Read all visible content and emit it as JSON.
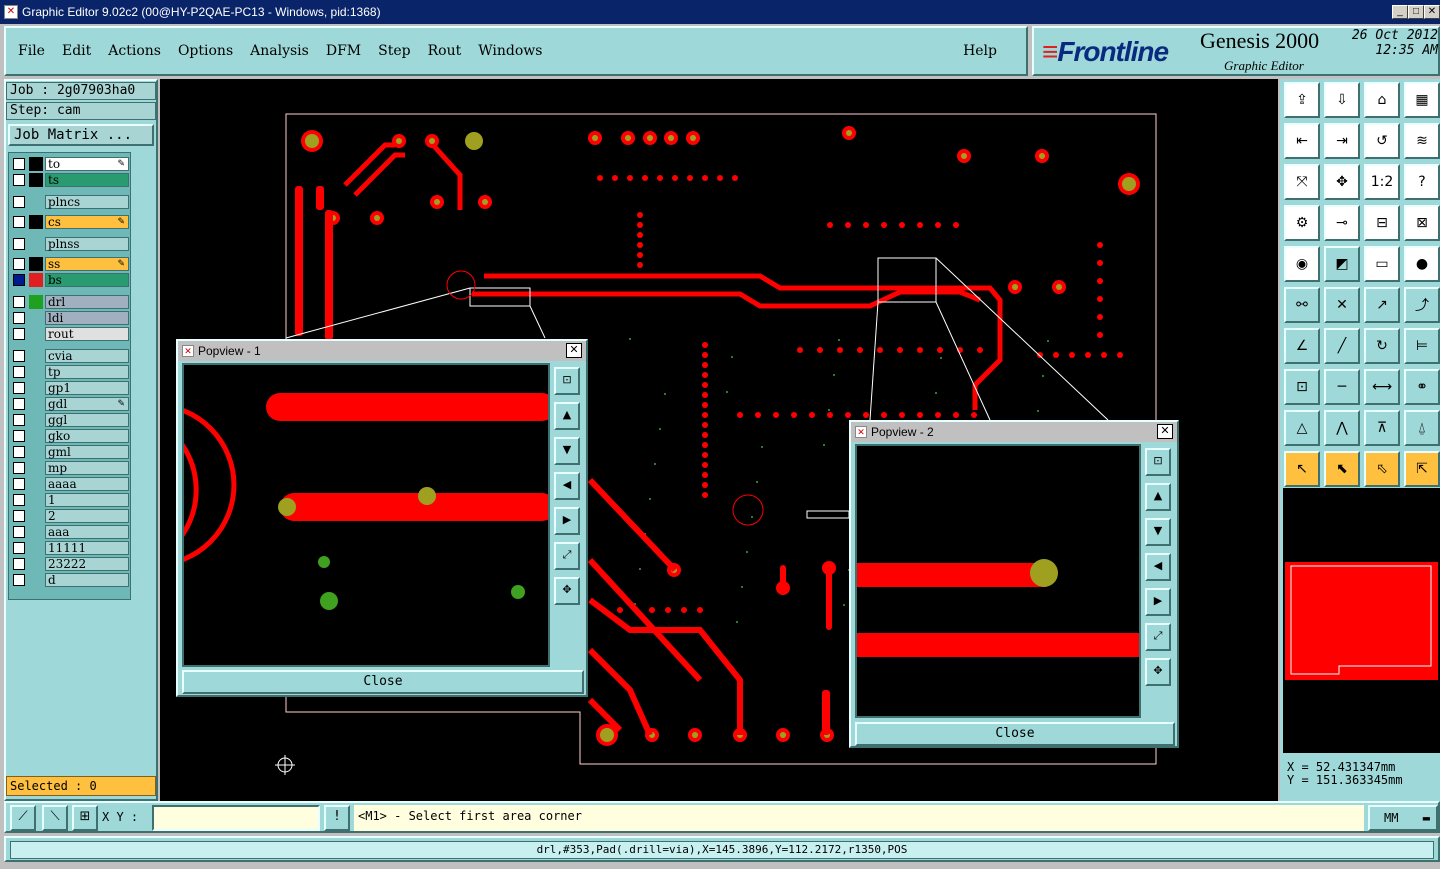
{
  "window": {
    "title": "Graphic Editor 9.02c2 (00@HY-P2QAE-PC13 - Windows, pid:1368)"
  },
  "menu": {
    "items": [
      "File",
      "Edit",
      "Actions",
      "Options",
      "Analysis",
      "DFM",
      "Step",
      "Rout",
      "Windows"
    ],
    "help": "Help"
  },
  "brand": {
    "logo": "Frontline",
    "product": "Genesis 2000",
    "subtitle": "Graphic Editor",
    "date": "26 Oct 2012",
    "time": "12:35 AM"
  },
  "job": {
    "job_label": "Job : 2g07903ha0",
    "step_label": "Step: cam",
    "matrix_button": "Job Matrix ..."
  },
  "layers": [
    {
      "name": "to",
      "color": "#ffffff",
      "swatch": "#000000",
      "checked": false,
      "edit": true
    },
    {
      "name": "ts",
      "color": "#2a9a70",
      "swatch": "#000000",
      "checked": false,
      "edit": false
    },
    {
      "name": "plncs",
      "color": "#a8d4d4",
      "swatch": "",
      "checked": false,
      "edit": false
    },
    {
      "name": "cs",
      "color": "#ffc040",
      "swatch": "#000000",
      "checked": false,
      "edit": true
    },
    {
      "name": "plnss",
      "color": "#a8d4d4",
      "swatch": "",
      "checked": false,
      "edit": false
    },
    {
      "name": "ss",
      "color": "#ffc040",
      "swatch": "#000000",
      "checked": false,
      "edit": true
    },
    {
      "name": "bs",
      "color": "#2a9a70",
      "swatch": "#e02020",
      "checked": true,
      "edit": false
    },
    {
      "name": "drl",
      "color": "#a0b0c0",
      "swatch": "#20a020",
      "checked": false,
      "edit": false
    },
    {
      "name": "ldi",
      "color": "#a0b0c0",
      "swatch": "",
      "checked": false,
      "edit": false
    },
    {
      "name": "rout",
      "color": "#e0e0e0",
      "swatch": "",
      "checked": false,
      "edit": false
    },
    {
      "name": "cvia",
      "color": "#a8d4d4",
      "swatch": "",
      "checked": false,
      "edit": false
    },
    {
      "name": "tp",
      "color": "#a8d4d4",
      "swatch": "",
      "checked": false,
      "edit": false
    },
    {
      "name": "gp1",
      "color": "#a8d4d4",
      "swatch": "",
      "checked": false,
      "edit": false
    },
    {
      "name": "gdl",
      "color": "#a8d4d4",
      "swatch": "",
      "checked": false,
      "edit": true
    },
    {
      "name": "ggl",
      "color": "#a8d4d4",
      "swatch": "",
      "checked": false,
      "edit": false
    },
    {
      "name": "gko",
      "color": "#a8d4d4",
      "swatch": "",
      "checked": false,
      "edit": false
    },
    {
      "name": "gml",
      "color": "#a8d4d4",
      "swatch": "",
      "checked": false,
      "edit": false
    },
    {
      "name": "mp",
      "color": "#a8d4d4",
      "swatch": "",
      "checked": false,
      "edit": false
    },
    {
      "name": "aaaa",
      "color": "#a8d4d4",
      "swatch": "",
      "checked": false,
      "edit": false
    },
    {
      "name": "1",
      "color": "#a8d4d4",
      "swatch": "",
      "checked": false,
      "edit": false
    },
    {
      "name": "2",
      "color": "#a8d4d4",
      "swatch": "",
      "checked": false,
      "edit": false
    },
    {
      "name": "aaa",
      "color": "#a8d4d4",
      "swatch": "",
      "checked": false,
      "edit": false
    },
    {
      "name": "11111",
      "color": "#a8d4d4",
      "swatch": "",
      "checked": false,
      "edit": false
    },
    {
      "name": "23222",
      "color": "#a8d4d4",
      "swatch": "",
      "checked": false,
      "edit": false
    },
    {
      "name": "d",
      "color": "#a8d4d4",
      "swatch": "",
      "checked": false,
      "edit": false
    }
  ],
  "selected": "Selected : 0",
  "popview1": {
    "title": "Popview - 1",
    "close": "Close"
  },
  "popview2": {
    "title": "Popview - 2",
    "close": "Close"
  },
  "coords": {
    "x": "X  =  52.431347mm",
    "y": "Y  = 151.363345mm"
  },
  "bottom": {
    "xy_label": "X Y :",
    "xy_value": "",
    "prompt": "<M1> - Select first area corner",
    "units": "MM"
  },
  "status": "drl,#353,Pad(.drill=via),X=145.3896,Y=112.2172,r1350,POS",
  "colors": {
    "panel": "#9fd8d8",
    "copper": "#ff0000",
    "drill": "#a0a020",
    "selected_bg": "#ffc040"
  }
}
